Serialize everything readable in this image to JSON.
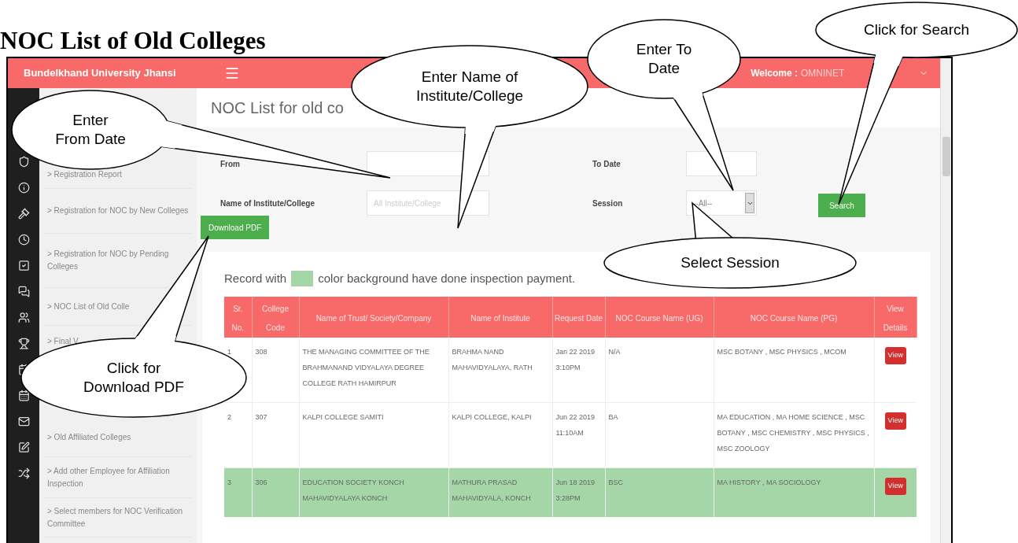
{
  "document_title": "NOC List of Old Colleges",
  "header": {
    "brand": "Bundelkhand University Jhansi",
    "welcome_label": "Welcome :",
    "user": "OMNINET"
  },
  "sidebar": {
    "items": [
      {
        "label": "> Registration Report"
      },
      {
        "label": "> Registration for NOC by New Colleges"
      },
      {
        "label": "> Registration for NOC by Pending Colleges"
      },
      {
        "label": "> NOC List of Old Colle"
      },
      {
        "label": "> Final V"
      },
      {
        "label": "> Old Affiliated Colleges"
      },
      {
        "label": "> Add other Employee for Affiliation Inspection"
      },
      {
        "label": "> Select members for NOC Verification Committee"
      }
    ]
  },
  "page_title": "NOC List for old co",
  "form": {
    "fields": [
      {
        "kind": "text",
        "label": "From"
      },
      {
        "kind": "text",
        "label": "To Date"
      },
      {
        "kind": "text",
        "label": "Name of Institute/College",
        "placeholder": "All Institute/College"
      },
      {
        "kind": "select",
        "label": "Session",
        "value": "--All--"
      }
    ],
    "search_button": "Search",
    "download_button": "Download PDF"
  },
  "legend": {
    "before": "Record with",
    "after": "color background have done inspection payment."
  },
  "table": {
    "columns": [
      "Sr. No.",
      "College Code",
      "Name of Trust/ Society/Company",
      "Name of Institute",
      "Request Date",
      "NOC Course Name (UG)",
      "NOC Course Name (PG)",
      "View Details"
    ],
    "rows": [
      {
        "paid": false,
        "cells": [
          "1",
          "308",
          "THE MANAGING COMMITTEE OF THE BRAHMANAND VIDYALAYA DEGREE COLLEGE RATH HAMIRPUR",
          "BRAHMA NAND MAHAVIDYALAYA, RATH",
          "Jan 22 2019 3:10PM",
          "N/A",
          "MSC BOTANY , MSC PHYSICS , MCOM"
        ],
        "action": "View"
      },
      {
        "paid": false,
        "cells": [
          "2",
          "307",
          "KALPI COLLEGE SAMITI",
          "KALPI COLLEGE, KALPI",
          "Jun 22 2019 11:10AM",
          "BA",
          "MA EDUCATION , MA HOME SCIENCE , MSC BOTANY , MSC CHEMISTRY , MSC PHYSICS , MSC ZOOLOGY"
        ],
        "action": "View"
      },
      {
        "paid": true,
        "cells": [
          "3",
          "306",
          "EDUCATION SOCIETY KONCH MAHAVIDYALAYA KONCH",
          "MATHURA PRASAD MAHAVIDYALA, KONCH",
          "Jun 18 2019 3:28PM",
          "BSC",
          "MA HISTORY , MA SOCIOLOGY"
        ],
        "action": "View"
      }
    ]
  },
  "callouts": [
    {
      "lines": [
        "Enter",
        "From Date"
      ]
    },
    {
      "lines": [
        "Enter Name of",
        "Institute/College"
      ]
    },
    {
      "lines": [
        "Enter To",
        "Date"
      ]
    },
    {
      "lines": [
        "Click for Search"
      ]
    },
    {
      "lines": [
        "Select Session"
      ]
    },
    {
      "lines": [
        "Click for",
        "Download PDF"
      ]
    }
  ]
}
